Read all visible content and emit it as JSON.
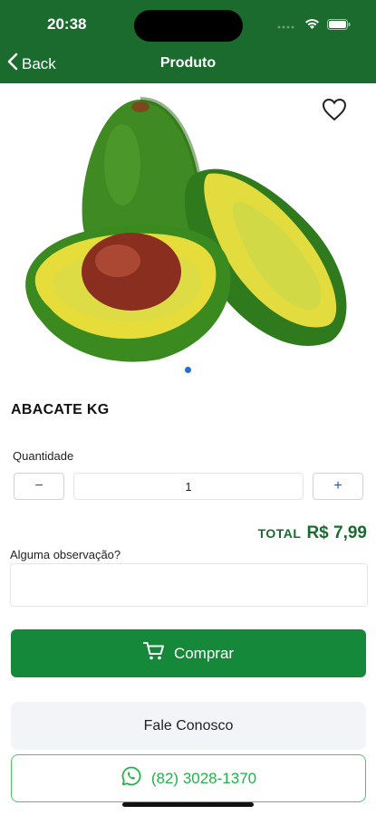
{
  "status_bar": {
    "time": "20:38"
  },
  "nav": {
    "back_label": "Back",
    "title": "Produto"
  },
  "product": {
    "name": "ABACATE KG",
    "image_subject": "avocado",
    "gallery": {
      "pages": 1,
      "current": 1
    },
    "favorite": false
  },
  "quantity": {
    "label": "Quantidade",
    "value": "1",
    "minus": "−",
    "plus": "+"
  },
  "total": {
    "label": "TOTAL",
    "value": "R$ 7,99"
  },
  "observation": {
    "label": "Alguma observação?",
    "value": "",
    "placeholder": ""
  },
  "buttons": {
    "buy": "Comprar",
    "contact": "Fale Conosco",
    "phone": "(82) 3028-1370"
  },
  "colors": {
    "header": "#1b6b2e",
    "primary": "#16883a",
    "whatsapp": "#23b14d",
    "dot": "#1f6fd6"
  },
  "icons": [
    "back-chevron-icon",
    "heart-icon",
    "cart-icon",
    "whatsapp-icon",
    "wifi-icon",
    "battery-icon",
    "signal-icon"
  ]
}
